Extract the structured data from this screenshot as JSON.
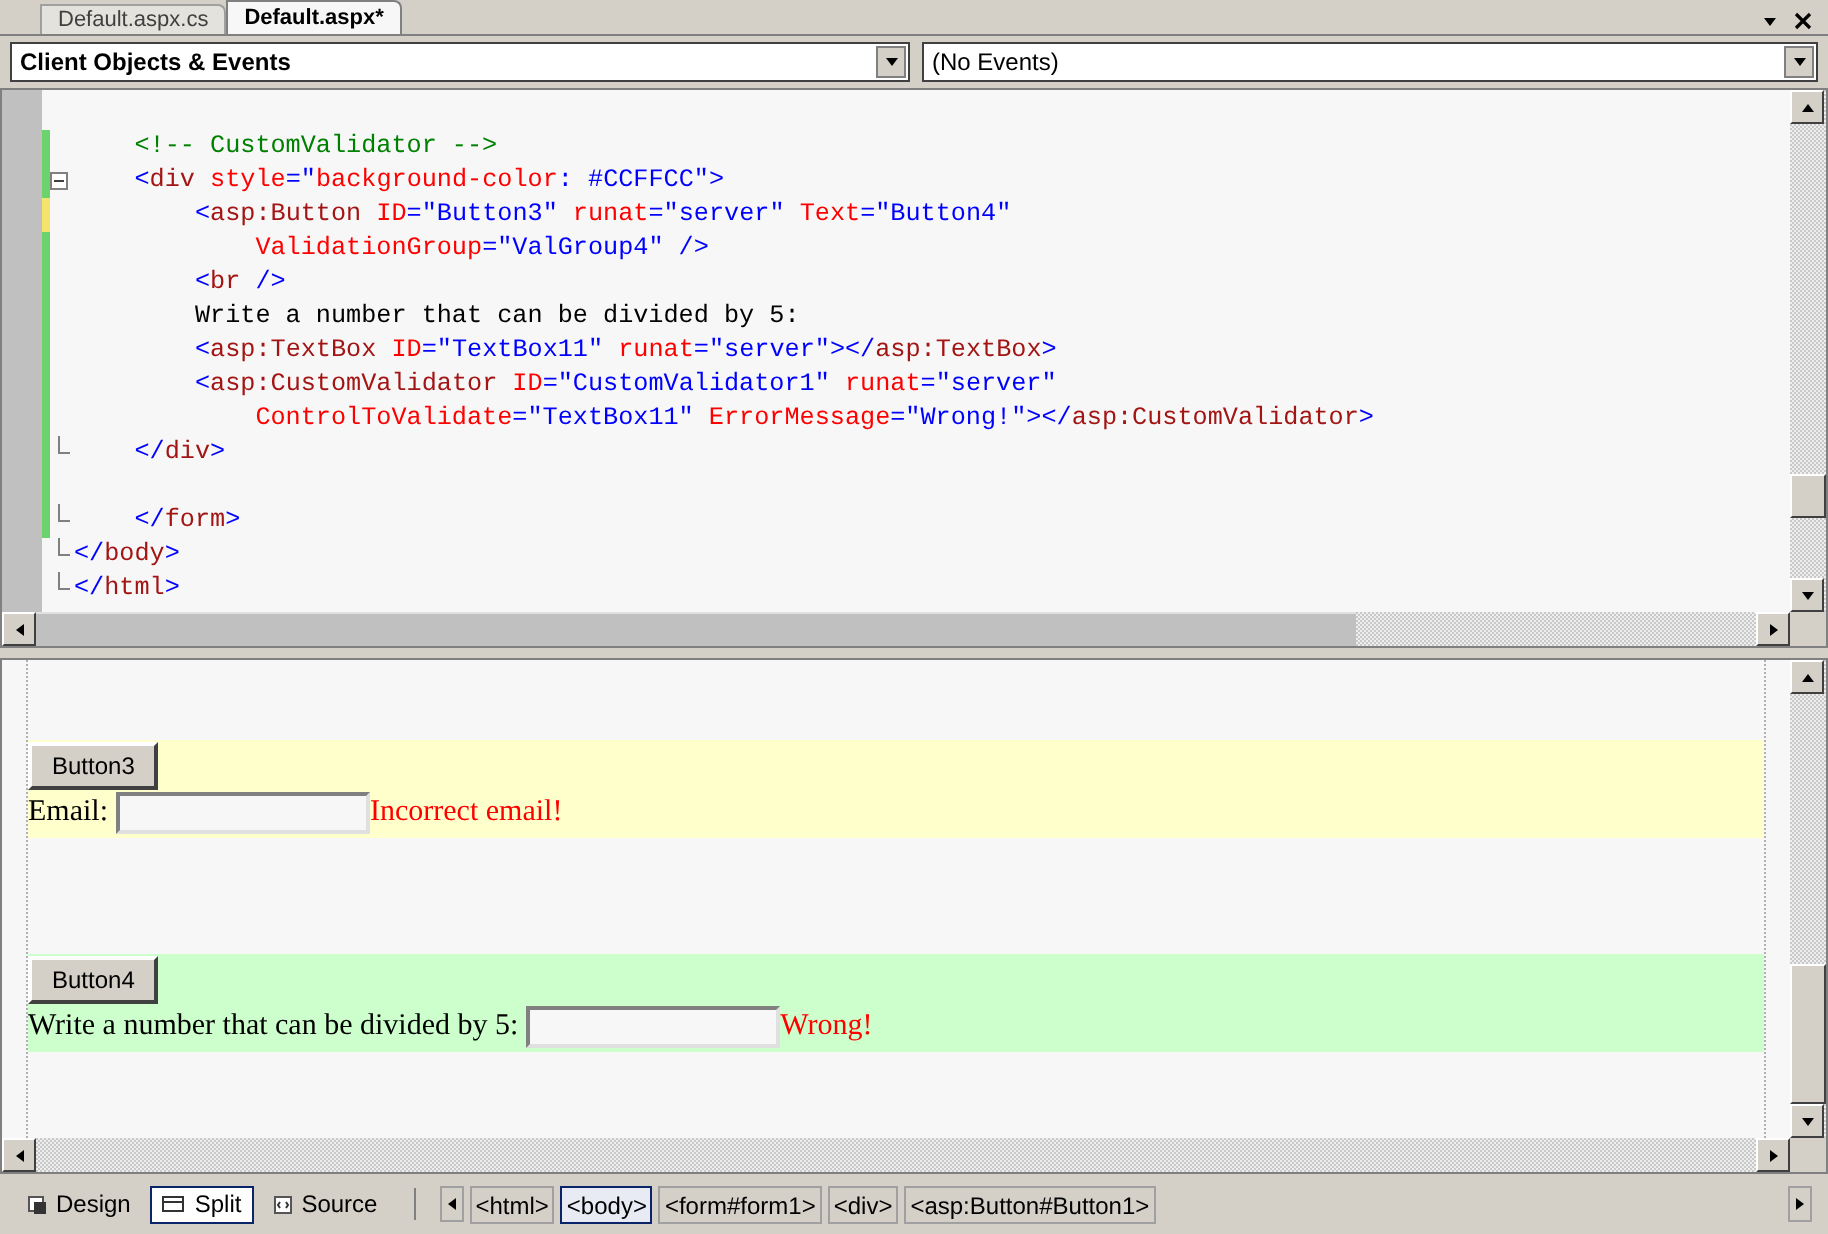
{
  "tabs": [
    {
      "label": "Default.aspx.cs",
      "selected": false
    },
    {
      "label": "Default.aspx*",
      "selected": true
    }
  ],
  "dropdowns": [
    {
      "value": "Client Objects & Events",
      "bold": true
    },
    {
      "value": "(No Events)",
      "bold": false
    }
  ],
  "code_lines": [
    {
      "edited": false,
      "unsaved": false,
      "foldable": false,
      "fold_end": false
    },
    {
      "edited": true,
      "unsaved": false,
      "foldable": false,
      "fold_end": false,
      "tokens": [
        {
          "kind": "comment",
          "text": "    <!-- CustomValidator -->"
        }
      ]
    },
    {
      "edited": true,
      "unsaved": false,
      "foldable": true,
      "fold_end": false,
      "tokens": [
        {
          "kind": "punct",
          "text": "    <"
        },
        {
          "kind": "element",
          "text": "div"
        },
        {
          "kind": "attr",
          "text": " style"
        },
        {
          "kind": "punct",
          "text": "=\""
        },
        {
          "kind": "attr",
          "text": "background-color"
        },
        {
          "kind": "punct",
          "text": ": #CCFFCC\">"
        }
      ]
    },
    {
      "edited": true,
      "unsaved": true,
      "foldable": false,
      "fold_end": false,
      "tokens": [
        {
          "kind": "punct",
          "text": "        <"
        },
        {
          "kind": "element",
          "text": "asp:Button"
        },
        {
          "kind": "attr",
          "text": " ID"
        },
        {
          "kind": "punct",
          "text": "=\"Button3\""
        },
        {
          "kind": "attr",
          "text": " runat"
        },
        {
          "kind": "punct",
          "text": "=\"server\""
        },
        {
          "kind": "attr",
          "text": " Text"
        },
        {
          "kind": "punct",
          "text": "=\"Button4\""
        }
      ]
    },
    {
      "edited": true,
      "unsaved": false,
      "foldable": false,
      "fold_end": false,
      "tokens": [
        {
          "kind": "attr",
          "text": "            ValidationGroup"
        },
        {
          "kind": "punct",
          "text": "=\"ValGroup4\" />"
        }
      ]
    },
    {
      "edited": true,
      "unsaved": false,
      "foldable": false,
      "fold_end": false,
      "tokens": [
        {
          "kind": "punct",
          "text": "        <"
        },
        {
          "kind": "element",
          "text": "br"
        },
        {
          "kind": "punct",
          "text": " />"
        }
      ]
    },
    {
      "edited": true,
      "unsaved": false,
      "foldable": false,
      "fold_end": false,
      "tokens": [
        {
          "kind": "text",
          "text": "        Write a number that can be divided by 5:"
        }
      ]
    },
    {
      "edited": true,
      "unsaved": false,
      "foldable": false,
      "fold_end": false,
      "tokens": [
        {
          "kind": "punct",
          "text": "        <"
        },
        {
          "kind": "element",
          "text": "asp:TextBox"
        },
        {
          "kind": "attr",
          "text": " ID"
        },
        {
          "kind": "punct",
          "text": "=\"TextBox11\""
        },
        {
          "kind": "attr",
          "text": " runat"
        },
        {
          "kind": "punct",
          "text": "=\"server\"></"
        },
        {
          "kind": "element",
          "text": "asp:TextBox"
        },
        {
          "kind": "punct",
          "text": ">"
        }
      ]
    },
    {
      "edited": true,
      "unsaved": false,
      "foldable": false,
      "fold_end": false,
      "tokens": [
        {
          "kind": "punct",
          "text": "        <"
        },
        {
          "kind": "element",
          "text": "asp:CustomValidator"
        },
        {
          "kind": "attr",
          "text": " ID"
        },
        {
          "kind": "punct",
          "text": "=\"CustomValidator1\""
        },
        {
          "kind": "attr",
          "text": " runat"
        },
        {
          "kind": "punct",
          "text": "=\"server\""
        }
      ]
    },
    {
      "edited": true,
      "unsaved": false,
      "foldable": false,
      "fold_end": false,
      "tokens": [
        {
          "kind": "attr",
          "text": "            ControlToValidate"
        },
        {
          "kind": "punct",
          "text": "=\"TextBox11\""
        },
        {
          "kind": "attr",
          "text": " ErrorMessage"
        },
        {
          "kind": "punct",
          "text": "=\"Wrong!\"></"
        },
        {
          "kind": "element",
          "text": "asp:CustomValidator"
        },
        {
          "kind": "punct",
          "text": ">"
        }
      ]
    },
    {
      "edited": true,
      "unsaved": false,
      "foldable": false,
      "fold_end": true,
      "tokens": [
        {
          "kind": "punct",
          "text": "    </"
        },
        {
          "kind": "element",
          "text": "div"
        },
        {
          "kind": "punct",
          "text": ">"
        }
      ]
    },
    {
      "edited": true,
      "unsaved": false,
      "foldable": false,
      "fold_end": false
    },
    {
      "edited": true,
      "unsaved": false,
      "foldable": false,
      "fold_end": true,
      "tokens": [
        {
          "kind": "punct",
          "text": "    </"
        },
        {
          "kind": "element",
          "text": "form"
        },
        {
          "kind": "punct",
          "text": ">"
        }
      ]
    },
    {
      "edited": false,
      "unsaved": false,
      "foldable": false,
      "fold_end": true,
      "tokens": [
        {
          "kind": "punct",
          "text": "</"
        },
        {
          "kind": "element",
          "text": "body"
        },
        {
          "kind": "punct",
          "text": ">"
        }
      ]
    },
    {
      "edited": false,
      "unsaved": false,
      "foldable": false,
      "fold_end": true,
      "tokens": [
        {
          "kind": "punct",
          "text": "</"
        },
        {
          "kind": "element",
          "text": "html"
        },
        {
          "kind": "punct",
          "text": ">"
        }
      ]
    }
  ],
  "design_blocks": [
    {
      "color": "#ffffcc",
      "button": "Button3",
      "label": "Email:",
      "error": "Incorrect email!"
    },
    {
      "color": "#ccffcc",
      "button": "Button4",
      "label": "Write a number that can be divided by 5:",
      "error": "Wrong!"
    }
  ],
  "view_tabs": [
    {
      "label": "Design",
      "selected": false,
      "kind": "design"
    },
    {
      "label": "Split",
      "selected": true,
      "kind": "split"
    },
    {
      "label": "Source",
      "selected": false,
      "kind": "source"
    }
  ],
  "breadcrumbs": [
    {
      "label": "<html>",
      "selected": false
    },
    {
      "label": "<body>",
      "selected": true
    },
    {
      "label": "<form#form1>",
      "selected": false
    },
    {
      "label": "<div>",
      "selected": false
    },
    {
      "label": "<asp:Button#Button1>",
      "selected": false
    }
  ]
}
